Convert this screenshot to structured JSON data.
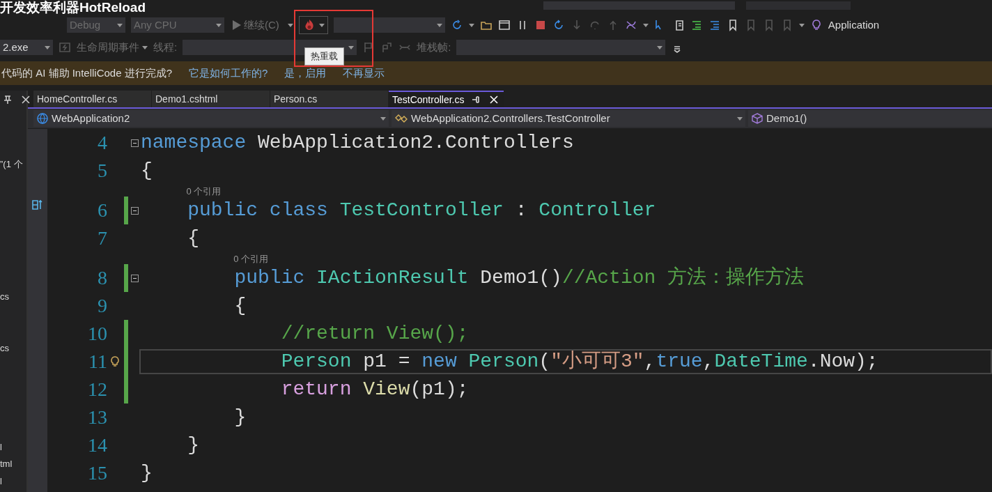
{
  "overlay_title": "开发效率利器HotReload",
  "toolbar_1": {
    "debug_config": "Debug",
    "platform": "Any CPU",
    "continue": "继续(C)",
    "hot_reload_highlighted": true,
    "application": "Application"
  },
  "toolbar_2": {
    "process": "2.exe",
    "lifecycle": "生命周期事件",
    "thread_label": "线程:",
    "stack_label": "堆栈帧:"
  },
  "tooltip": "热重载",
  "info_bar": {
    "message": "代码的 AI 辅助 IntelliCode 进行完成?",
    "links": [
      "它是如何工作的?",
      "是，启用",
      "不再显示"
    ]
  },
  "tabs": [
    {
      "label": "HomeController.cs",
      "selected": false
    },
    {
      "label": "Demo1.cshtml",
      "selected": false
    },
    {
      "label": "Person.cs",
      "selected": false
    },
    {
      "label": "TestController.cs",
      "selected": true
    }
  ],
  "nav_bar": {
    "project": "WebApplication2",
    "class": "WebApplication2.Controllers.TestController",
    "member": "Demo1()"
  },
  "side_panel": {
    "items": [
      "”(1 个",
      "cs",
      "cs",
      "l",
      "tml",
      "l"
    ]
  },
  "code_lines": [
    {
      "number": "4",
      "collapsible": true,
      "changed": false,
      "current": false,
      "tokens": [
        {
          "kind": "keyword",
          "text": "namespace"
        },
        {
          "kind": "plain",
          "text": " WebApplication2.Controllers"
        }
      ]
    },
    {
      "number": "5",
      "collapsible": false,
      "changed": false,
      "current": false,
      "tokens": [
        {
          "kind": "plain",
          "text": "{"
        }
      ]
    },
    {
      "number": "6",
      "collapsible": true,
      "changed": true,
      "current": false,
      "lens": "0 个引用",
      "tokens": [
        {
          "kind": "keyword",
          "text": "    public class "
        },
        {
          "kind": "type",
          "text": "TestController"
        },
        {
          "kind": "plain",
          "text": " : "
        },
        {
          "kind": "type",
          "text": "Controller"
        }
      ]
    },
    {
      "number": "7",
      "collapsible": false,
      "changed": false,
      "current": false,
      "tokens": [
        {
          "kind": "plain",
          "text": "    {"
        }
      ]
    },
    {
      "number": "8",
      "collapsible": true,
      "changed": true,
      "current": false,
      "lens": "0 个引用",
      "tokens": [
        {
          "kind": "keyword",
          "text": "        public "
        },
        {
          "kind": "type",
          "text": "IActionResult"
        },
        {
          "kind": "plain",
          "text": " Demo1()"
        },
        {
          "kind": "comment",
          "text": "//Action 方法：操作方法"
        }
      ]
    },
    {
      "number": "9",
      "collapsible": false,
      "changed": false,
      "current": false,
      "tokens": [
        {
          "kind": "plain",
          "text": "        {"
        }
      ]
    },
    {
      "number": "10",
      "collapsible": false,
      "changed": true,
      "current": false,
      "tokens": [
        {
          "kind": "comment",
          "text": "            //return View();"
        }
      ]
    },
    {
      "number": "11",
      "collapsible": false,
      "changed": true,
      "current": true,
      "tokens": [
        {
          "kind": "type",
          "text": "            Person"
        },
        {
          "kind": "plain",
          "text": " p1 = "
        },
        {
          "kind": "keyword",
          "text": "new "
        },
        {
          "kind": "type",
          "text": "Person"
        },
        {
          "kind": "plain",
          "text": "("
        },
        {
          "kind": "string",
          "text": "\"小可可3\""
        },
        {
          "kind": "plain",
          "text": ","
        },
        {
          "kind": "keyword",
          "text": "true"
        },
        {
          "kind": "plain",
          "text": ","
        },
        {
          "kind": "type",
          "text": "DateTime"
        },
        {
          "kind": "plain",
          "text": ".Now);"
        }
      ]
    },
    {
      "number": "12",
      "collapsible": false,
      "changed": true,
      "current": false,
      "tokens": [
        {
          "kind": "control",
          "text": "            return "
        },
        {
          "kind": "method",
          "text": "View"
        },
        {
          "kind": "plain",
          "text": "(p1);"
        }
      ]
    },
    {
      "number": "13",
      "collapsible": false,
      "changed": false,
      "current": false,
      "tokens": [
        {
          "kind": "plain",
          "text": "        }"
        }
      ]
    },
    {
      "number": "14",
      "collapsible": false,
      "changed": false,
      "current": false,
      "tokens": [
        {
          "kind": "plain",
          "text": "    }"
        }
      ]
    },
    {
      "number": "15",
      "collapsible": false,
      "changed": false,
      "current": false,
      "tokens": [
        {
          "kind": "plain",
          "text": "}"
        }
      ]
    }
  ]
}
